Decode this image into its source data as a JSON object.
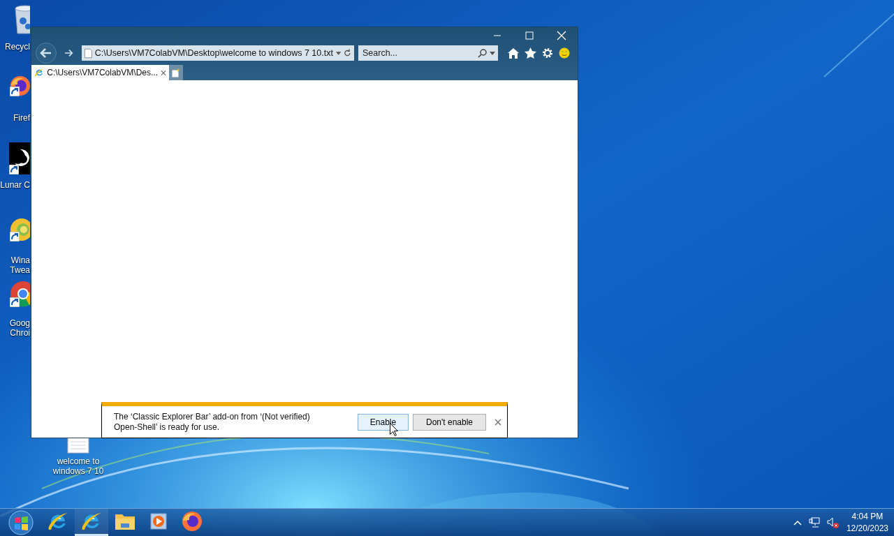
{
  "desktop_icons": [
    {
      "kind": "recycle",
      "label": "Recycl",
      "shortcut": false
    },
    {
      "kind": "firefox",
      "label": "Firef",
      "shortcut": true
    },
    {
      "kind": "moon",
      "label": "Lunar C",
      "shortcut": true
    },
    {
      "kind": "tweaker",
      "label": "Wina\nTwea",
      "shortcut": true
    },
    {
      "kind": "chrome",
      "label": "Goog\nChroi",
      "shortcut": true
    }
  ],
  "file_icon": {
    "label": "welcome to\nwindows 7 10"
  },
  "browser": {
    "address": "C:\\Users\\VM7ColabVM\\Desktop\\welcome to windows 7 10.txt",
    "search": {
      "placeholder": "Search..."
    },
    "tabs": [
      {
        "label": "C:\\Users\\VM7ColabVM\\Des...",
        "selected": true
      }
    ],
    "notification": {
      "message": "The ‘Classic Explorer Bar’ add-on from ‘(Not verified) Open-Shell’ is ready for use.",
      "buttons": [
        {
          "label": "Enable",
          "selected": true
        },
        {
          "label": "Don't enable",
          "selected": false
        }
      ]
    }
  },
  "taskbar": {
    "apps": [
      {
        "kind": "ie",
        "selected": false
      },
      {
        "kind": "ie",
        "selected": true
      },
      {
        "kind": "folder",
        "selected": false
      },
      {
        "kind": "media",
        "selected": false
      },
      {
        "kind": "firefox",
        "selected": false
      }
    ],
    "clock": {
      "time": "4:04 PM",
      "date": "12/20/2023"
    }
  }
}
